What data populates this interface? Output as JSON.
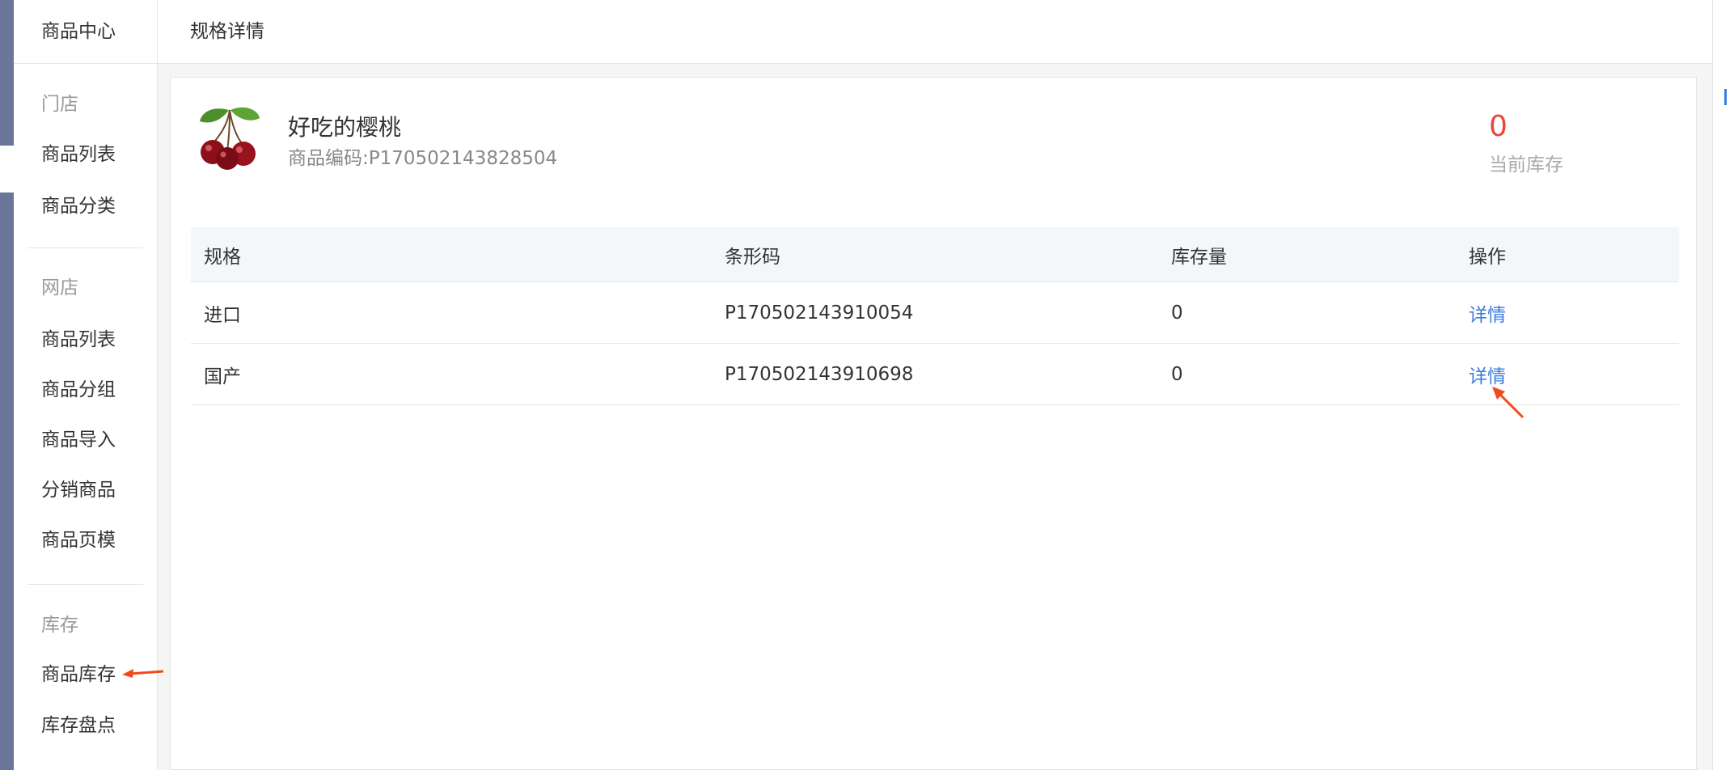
{
  "sidebar": {
    "title": "商品中心",
    "groups": [
      {
        "title": "门店",
        "items": [
          "商品列表",
          "商品分类"
        ]
      },
      {
        "title": "网店",
        "items": [
          "商品列表",
          "商品分组",
          "商品导入",
          "分销商品",
          "商品页模"
        ]
      },
      {
        "title": "库存",
        "items": [
          "商品库存",
          "库存盘点"
        ]
      }
    ]
  },
  "header": {
    "title": "规格详情"
  },
  "product": {
    "name": "好吃的樱桃",
    "code_label": "商品编码:",
    "code": "P170502143828504",
    "stock_value": "0",
    "stock_label": "当前库存"
  },
  "table": {
    "headers": [
      "规格",
      "条形码",
      "库存量",
      "操作"
    ],
    "rows": [
      {
        "spec": "进口",
        "barcode": "P170502143910054",
        "stock": "0",
        "action": "详情"
      },
      {
        "spec": "国产",
        "barcode": "P170502143910698",
        "stock": "0",
        "action": "详情"
      }
    ]
  },
  "colors": {
    "accent": "#3a7ee0",
    "stock": "#e8473f",
    "nav_strip": "#6b7598",
    "annotation_arrow": "#f04a1e"
  },
  "icons": {
    "product": "cherry-icon"
  }
}
